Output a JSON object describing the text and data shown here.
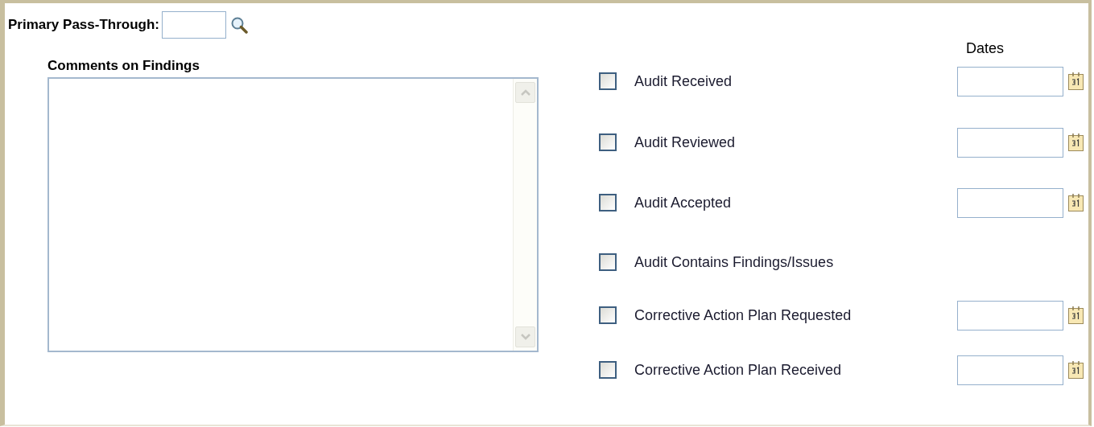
{
  "pass_through": {
    "label": "Primary Pass-Through:"
  },
  "comments": {
    "label": "Comments on Findings"
  },
  "dates_header": "Dates",
  "items": [
    {
      "label": "Audit Received",
      "checked": false,
      "kind": "dated"
    },
    {
      "label": "Audit Reviewed",
      "checked": false,
      "kind": "dated"
    },
    {
      "label": "Audit Accepted",
      "checked": false,
      "kind": "dated"
    },
    {
      "label": "Audit Contains Findings/Issues",
      "checked": false,
      "kind": "plain"
    },
    {
      "label": "Corrective Action Plan Requested",
      "checked": false,
      "kind": "dated"
    },
    {
      "label": "Corrective Action Plan Received",
      "checked": false,
      "kind": "dated"
    }
  ]
}
